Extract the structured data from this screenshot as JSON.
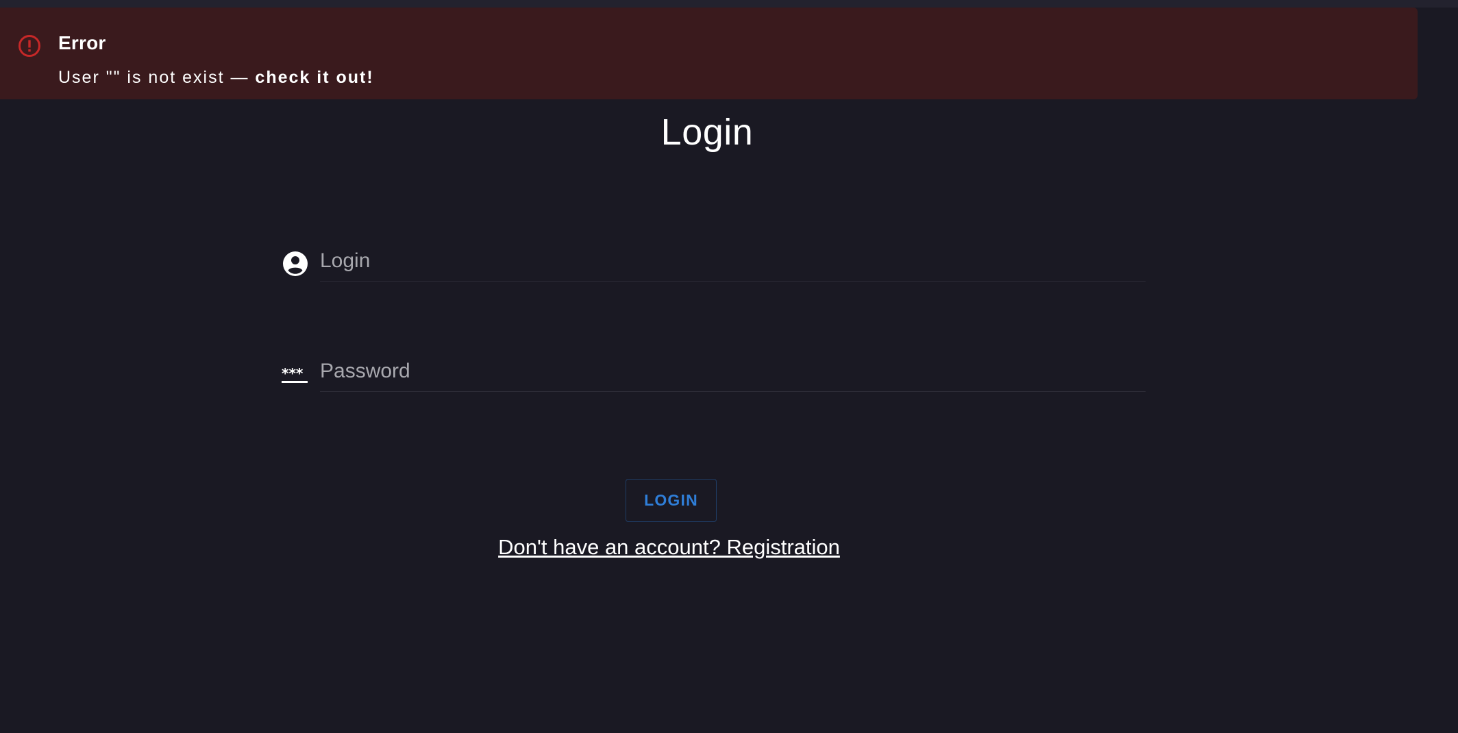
{
  "alert": {
    "title": "Error",
    "message_prefix": "User \"\" is not exist — ",
    "message_emphasis": "check it out!",
    "icon": "error-circle-icon",
    "color": "#c62828"
  },
  "page": {
    "title": "Login"
  },
  "form": {
    "login_field": {
      "placeholder": "Login",
      "value": "",
      "icon": "account-circle-icon"
    },
    "password_field": {
      "placeholder": "Password",
      "value": "",
      "icon": "password-dots-icon"
    },
    "submit_label": "LOGIN",
    "register_link": "Don't have an account? Registration"
  },
  "colors": {
    "background": "#1a1923",
    "alert_background": "#3a1a1d",
    "accent": "#2f7ed8"
  }
}
